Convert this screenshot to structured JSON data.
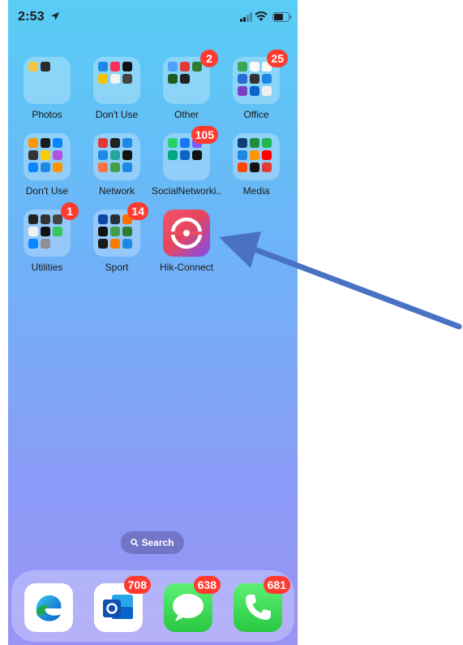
{
  "status_bar": {
    "time": "2:53"
  },
  "apps": [
    {
      "id": "photos",
      "label": "Photos",
      "badge": ""
    },
    {
      "id": "dontuse1",
      "label": "Don't Use",
      "badge": ""
    },
    {
      "id": "other",
      "label": "Other",
      "badge": "2"
    },
    {
      "id": "office",
      "label": "Office",
      "badge": "25"
    },
    {
      "id": "dontuse2",
      "label": "Don't Use",
      "badge": ""
    },
    {
      "id": "network",
      "label": "Network",
      "badge": ""
    },
    {
      "id": "social",
      "label": "SocialNetworki...",
      "badge": "105"
    },
    {
      "id": "media",
      "label": "Media",
      "badge": ""
    },
    {
      "id": "utilities",
      "label": "Utilities",
      "badge": "1"
    },
    {
      "id": "sport",
      "label": "Sport",
      "badge": "14"
    },
    {
      "id": "hik",
      "label": "Hik-Connect",
      "badge": ""
    }
  ],
  "search": {
    "label": "Search"
  },
  "dock": [
    {
      "id": "edge",
      "badge": ""
    },
    {
      "id": "outlook",
      "badge": "708"
    },
    {
      "id": "messages",
      "badge": "638"
    },
    {
      "id": "phone",
      "badge": "681"
    }
  ],
  "colors": {
    "badge": "#ff3b30",
    "arrow": "#4a72c4"
  }
}
